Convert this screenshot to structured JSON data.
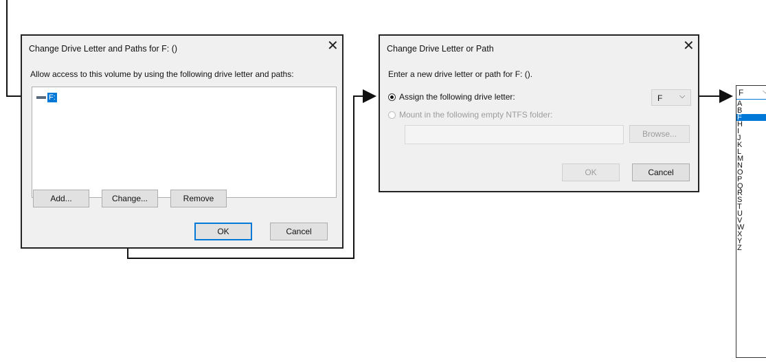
{
  "dialog1": {
    "title": "Change Drive Letter and Paths for F: ()",
    "instructions": "Allow access to this volume by using the following drive letter and paths:",
    "list_item": "F:",
    "buttons": {
      "add": "Add...",
      "change": "Change...",
      "remove": "Remove",
      "ok": "OK",
      "cancel": "Cancel"
    },
    "close": "✕"
  },
  "dialog2": {
    "title": "Change Drive Letter or Path",
    "instructions": "Enter a new drive letter or path for F: ().",
    "option_assign": "Assign the following drive letter:",
    "option_mount": "Mount in the following empty NTFS folder:",
    "drive_select_value": "F",
    "buttons": {
      "browse": "Browse...",
      "ok": "OK",
      "cancel": "Cancel"
    },
    "close": "✕"
  },
  "dropdown": {
    "selected_value": "F",
    "items": [
      "A",
      "B",
      "F",
      "H",
      "I",
      "J",
      "K",
      "L",
      "M",
      "N",
      "O",
      "P",
      "Q",
      "R",
      "S",
      "T",
      "U",
      "V",
      "W",
      "X",
      "Y",
      "Z"
    ],
    "highlighted": "F"
  },
  "colors": {
    "selection": "#0078d7",
    "dialog_bg": "#f0f0f0"
  }
}
